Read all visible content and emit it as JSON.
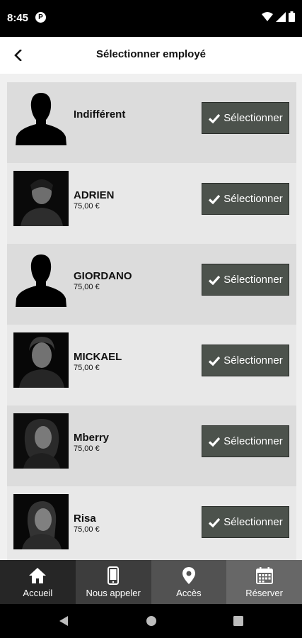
{
  "status_bar": {
    "time": "8:45",
    "app_icon_letter": "P"
  },
  "header": {
    "title": "Sélectionner employé"
  },
  "employees": [
    {
      "name": "Indifférent",
      "price": "",
      "avatar": "silhouette",
      "button_label": "Sélectionner"
    },
    {
      "name": "ADRIEN",
      "price": "75,00 €",
      "avatar": "photo",
      "button_label": "Sélectionner"
    },
    {
      "name": "GIORDANO",
      "price": "75,00 €",
      "avatar": "silhouette",
      "button_label": "Sélectionner"
    },
    {
      "name": "MICKAEL",
      "price": "75,00 €",
      "avatar": "photo",
      "button_label": "Sélectionner"
    },
    {
      "name": "Mberry",
      "price": "75,00 €",
      "avatar": "photo",
      "button_label": "Sélectionner"
    },
    {
      "name": "Risa",
      "price": "75,00 €",
      "avatar": "photo",
      "button_label": "Sélectionner"
    }
  ],
  "bottom_nav": [
    {
      "label": "Accueil",
      "icon": "home-icon",
      "bg": "#262626"
    },
    {
      "label": "Nous appeler",
      "icon": "phone-icon",
      "bg": "#3d3d3d"
    },
    {
      "label": "Accès",
      "icon": "map-pin-icon",
      "bg": "#525252"
    },
    {
      "label": "Réserver",
      "icon": "calendar-icon",
      "bg": "#676767"
    }
  ],
  "colors": {
    "button_bg": "#4c524c",
    "row_dark": "#dcdcdc",
    "row_light": "#e8e8e8"
  }
}
